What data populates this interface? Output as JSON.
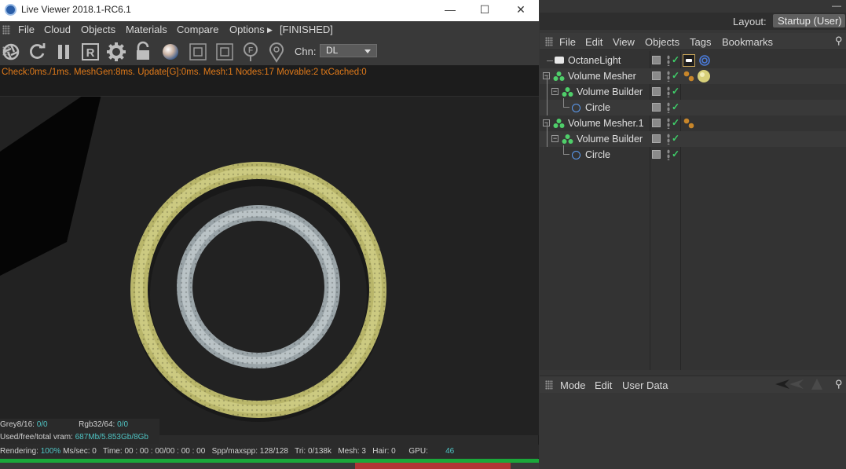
{
  "live_viewer": {
    "window_title": "Live Viewer 2018.1-RC6.1",
    "controls": {
      "minimize": "—",
      "maximize": "☐",
      "close": "✕"
    },
    "menu": [
      "File",
      "Cloud",
      "Objects",
      "Materials",
      "Compare",
      "Options"
    ],
    "status_tag": "[FINISHED]",
    "toolbar_icons": [
      "aperture-icon",
      "refresh-icon",
      "pause-icon",
      "region-icon",
      "settings-gear-icon",
      "lock-icon",
      "material-sphere-icon",
      "frame-icon",
      "frame-alt-icon",
      "focus-pick-icon",
      "pin-icon"
    ],
    "toolbar_letters": {
      "region": "R",
      "focus": "F"
    },
    "channel_label": "Chn:",
    "channel_value": "DL",
    "stats_line": "Check:0ms./1ms. MeshGen:8ms. Update[G]:0ms. Mesh:1 Nodes:17 Movable:2 txCached:0",
    "info": {
      "grey_label": "Grey8/16:",
      "grey_value": "0/0",
      "rgb_label": "Rgb32/64:",
      "rgb_value": "0/0",
      "vram_label": "Used/free/total vram:",
      "vram_value": "687Mb/5.853Gb/8Gb"
    },
    "statusbar": {
      "rendering_label": "Rendering:",
      "rendering_value": "100%",
      "ms_label": "Ms/sec:",
      "ms_value": "0",
      "time_label": "Time:",
      "time_value": "00 : 00 : 00/00 : 00 : 00",
      "spp_label": "Spp/maxspp:",
      "spp_value": "128/128",
      "tri_label": "Tri:",
      "tri_value": "0/138k",
      "mesh_label": "Mesh:",
      "mesh_value": "3",
      "hair_label": "Hair:",
      "hair_value": "0",
      "gpu_label": "GPU:",
      "gpu_value": "46"
    },
    "render_progress": 1.0,
    "accent_color": "#e07a1a",
    "value_color": "#4fc3c3"
  },
  "layout": {
    "label": "Layout:",
    "value": "Startup (User)"
  },
  "object_manager": {
    "menu": [
      "File",
      "Edit",
      "View",
      "Objects",
      "Tags",
      "Bookmarks"
    ],
    "rows": [
      {
        "name": "OctaneLight",
        "icon": "light-icon",
        "tags": [
          "octane-light-tag-icon",
          "target-tag-icon"
        ]
      },
      {
        "name": "Volume Mesher",
        "icon": "volume-mesher-icon",
        "tags": [
          "material-tag-icon",
          "yellow-material-icon"
        ]
      },
      {
        "name": "Volume Builder",
        "icon": "volume-builder-icon",
        "tags": []
      },
      {
        "name": "Circle",
        "icon": "circle-spline-icon",
        "tags": []
      },
      {
        "name": "Volume Mesher.1",
        "icon": "volume-mesher-icon",
        "tags": [
          "material-tag-icon"
        ]
      },
      {
        "name": "Volume Builder",
        "icon": "volume-builder-icon",
        "tags": []
      },
      {
        "name": "Circle",
        "icon": "circle-spline-icon",
        "tags": []
      }
    ]
  },
  "attribute_manager": {
    "menu": [
      "Mode",
      "Edit",
      "User Data"
    ]
  }
}
